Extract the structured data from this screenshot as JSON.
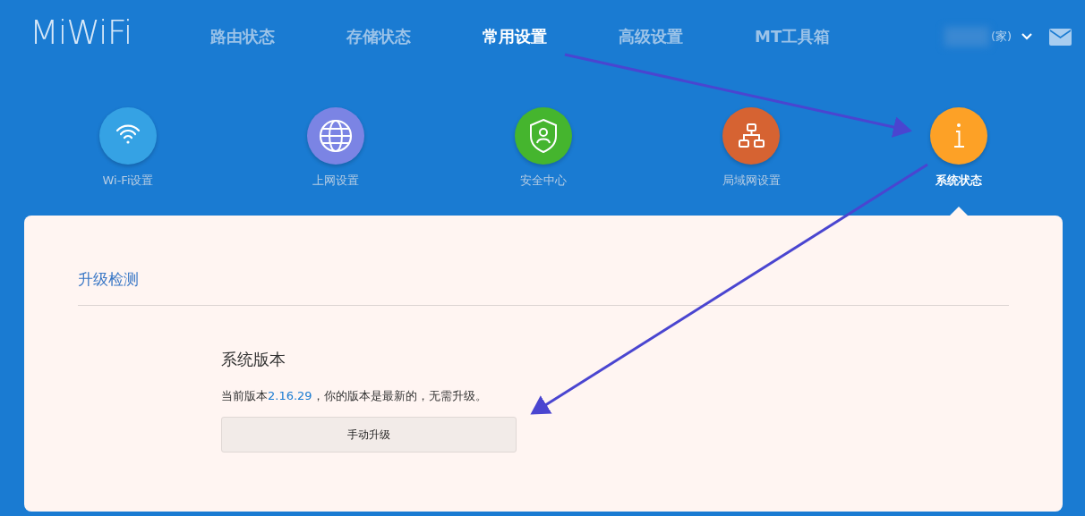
{
  "logo": "MiWiFi",
  "nav_tabs": [
    {
      "label": "路由状态",
      "selected": false
    },
    {
      "label": "存储状态",
      "selected": false
    },
    {
      "label": "常用设置",
      "selected": true
    },
    {
      "label": "高级设置",
      "selected": false
    },
    {
      "label": "MT工具箱",
      "selected": false
    }
  ],
  "user_menu": {
    "label": "(家)"
  },
  "settings_items": [
    {
      "kind": "wifi",
      "label": "Wi-Fi设置",
      "color": "#35a2e4",
      "selected": false
    },
    {
      "kind": "globe",
      "label": "上网设置",
      "color": "#7b84e4",
      "selected": false
    },
    {
      "kind": "shield",
      "label": "安全中心",
      "color": "#45b52e",
      "selected": false
    },
    {
      "kind": "lan",
      "label": "局域网设置",
      "color": "#d66332",
      "selected": false
    },
    {
      "kind": "info",
      "label": "系统状态",
      "color": "#fda126",
      "selected": true
    }
  ],
  "panel": {
    "title": "升级检测",
    "section_title": "系统版本",
    "status_prefix": "当前版本",
    "version": "2.16.29",
    "status_suffix": "，你的版本是最新的，无需升级。",
    "button": "手动升级"
  }
}
